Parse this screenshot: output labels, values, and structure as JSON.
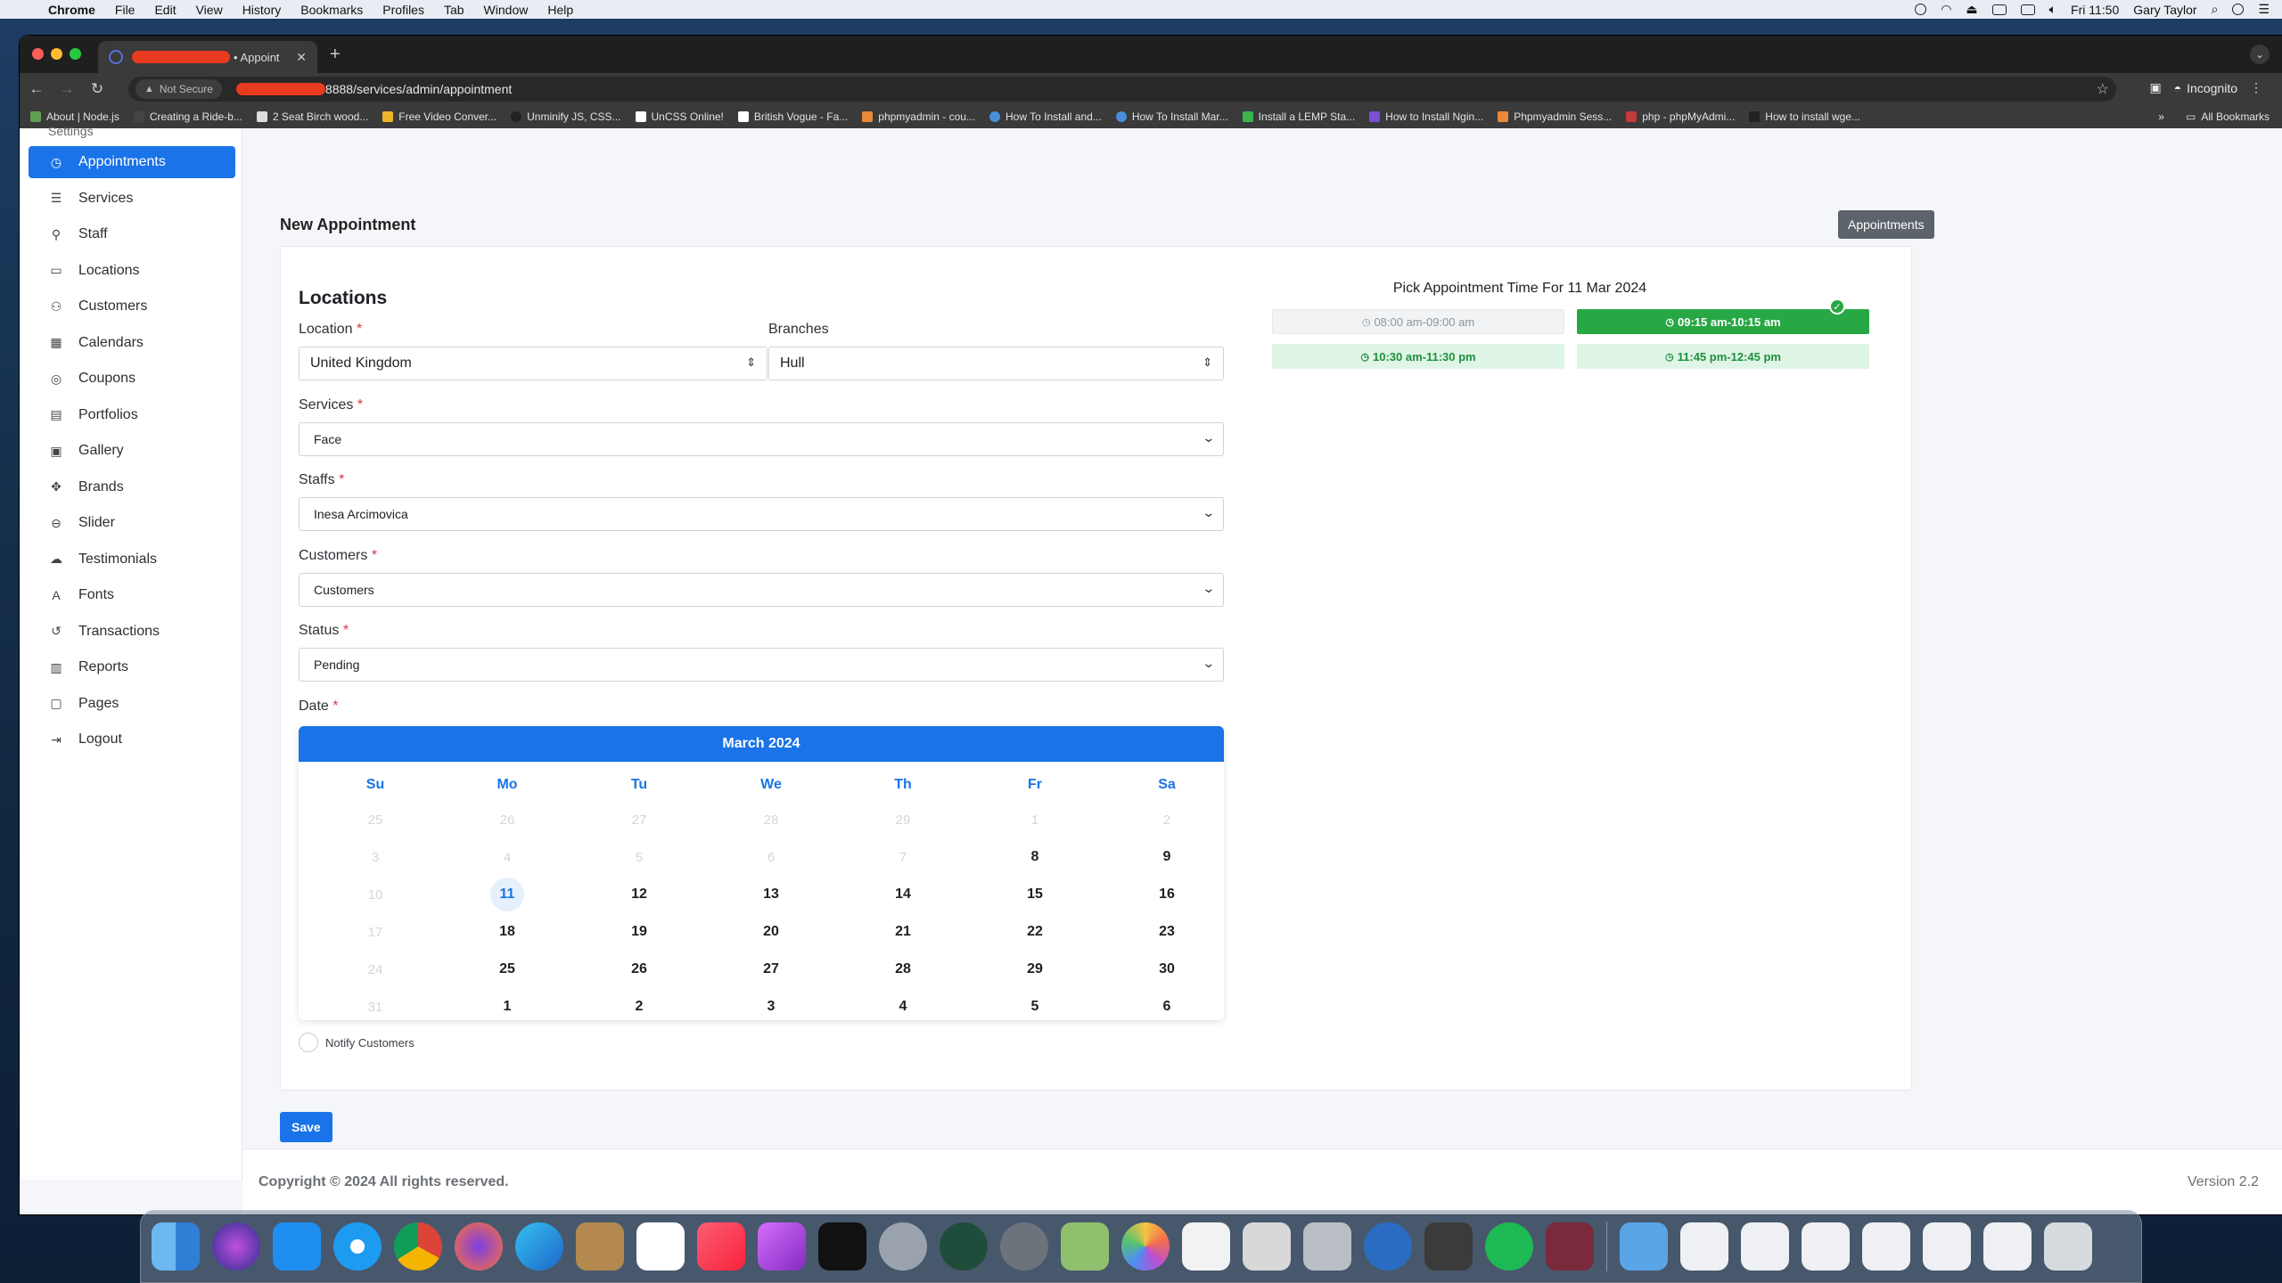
{
  "menubar": {
    "app": "Chrome",
    "items": [
      "File",
      "Edit",
      "View",
      "History",
      "Bookmarks",
      "Profiles",
      "Tab",
      "Window",
      "Help"
    ],
    "clock": "Fri 11:50",
    "user": "Gary Taylor"
  },
  "browser": {
    "tab_title": "• Appoint",
    "url": "8888/services/admin/appointment",
    "security_label": "Not Secure",
    "incognito_label": "Incognito",
    "bookmarks": [
      "About | Node.js",
      "Creating a Ride-b...",
      "2 Seat Birch wood...",
      "Free Video Conver...",
      "Unminify JS, CSS...",
      "UnCSS Online!",
      "British Vogue - Fa...",
      "phpmyadmin - cou...",
      "How To Install and...",
      "How To Install Mar...",
      "Install a LEMP Sta...",
      "How to Install Ngin...",
      "Phpmyadmin Sess...",
      "php - phpMyAdmi...",
      "How to install wge..."
    ],
    "all_bookmarks": "All Bookmarks"
  },
  "sidebar": {
    "cut_item": "Settings",
    "items": [
      {
        "label": "Appointments",
        "icon": "clock-icon",
        "glyph": "◷",
        "active": true
      },
      {
        "label": "Services",
        "icon": "layers-icon",
        "glyph": "☰"
      },
      {
        "label": "Staff",
        "icon": "staff-icon",
        "glyph": "⚲"
      },
      {
        "label": "Locations",
        "icon": "building-icon",
        "glyph": "▭"
      },
      {
        "label": "Customers",
        "icon": "users-icon",
        "glyph": "⚇"
      },
      {
        "label": "Calendars",
        "icon": "calendar-icon",
        "glyph": "▦"
      },
      {
        "label": "Coupons",
        "icon": "coupon-icon",
        "glyph": "◎"
      },
      {
        "label": "Portfolios",
        "icon": "portfolio-icon",
        "glyph": "▤"
      },
      {
        "label": "Gallery",
        "icon": "image-icon",
        "glyph": "▣"
      },
      {
        "label": "Brands",
        "icon": "brand-icon",
        "glyph": "✥"
      },
      {
        "label": "Slider",
        "icon": "slider-icon",
        "glyph": "⊖"
      },
      {
        "label": "Testimonials",
        "icon": "chat-icon",
        "glyph": "☁"
      },
      {
        "label": "Fonts",
        "icon": "font-icon",
        "glyph": "A"
      },
      {
        "label": "Transactions",
        "icon": "history-icon",
        "glyph": "↺"
      },
      {
        "label": "Reports",
        "icon": "chart-icon",
        "glyph": "▥"
      },
      {
        "label": "Pages",
        "icon": "pages-icon",
        "glyph": "▢"
      },
      {
        "label": "Logout",
        "icon": "logout-icon",
        "glyph": "⇥"
      }
    ]
  },
  "page": {
    "title": "New Appointment",
    "header_button": "Appointments",
    "section_title": "Locations",
    "location_label": "Location",
    "location_value": "United Kingdom",
    "branches_label": "Branches",
    "branches_value": "Hull",
    "services_label": "Services",
    "services_value": "Face",
    "staffs_label": "Staffs",
    "staffs_value": "Inesa Arcimovica",
    "customers_label": "Customers",
    "customers_value": "Customers",
    "status_label": "Status",
    "status_value": "Pending",
    "date_label": "Date",
    "required_mark": "*",
    "notify_label": "Notify Customers",
    "save_label": "Save"
  },
  "calendar": {
    "month": "March 2024",
    "weekdays": [
      "Su",
      "Mo",
      "Tu",
      "We",
      "Th",
      "Fr",
      "Sa"
    ],
    "weeks": [
      [
        25,
        26,
        27,
        28,
        29,
        1,
        2
      ],
      [
        3,
        4,
        5,
        6,
        7,
        8,
        9
      ],
      [
        10,
        11,
        12,
        13,
        14,
        15,
        16
      ],
      [
        17,
        18,
        19,
        20,
        21,
        22,
        23
      ],
      [
        24,
        25,
        26,
        27,
        28,
        29,
        30
      ],
      [
        31,
        1,
        2,
        3,
        4,
        5,
        6
      ]
    ],
    "disabled": [
      [
        0,
        0
      ],
      [
        0,
        1
      ],
      [
        0,
        2
      ],
      [
        0,
        3
      ],
      [
        0,
        4
      ],
      [
        0,
        5
      ],
      [
        0,
        6
      ],
      [
        1,
        0
      ],
      [
        1,
        1
      ],
      [
        1,
        2
      ],
      [
        1,
        3
      ],
      [
        1,
        4
      ],
      [
        2,
        0
      ],
      [
        3,
        0
      ],
      [
        4,
        0
      ],
      [
        5,
        0
      ]
    ],
    "today": [
      2,
      1
    ]
  },
  "time_slots": {
    "title": "Pick Appointment Time For 11 Mar 2024",
    "slots": [
      {
        "label": "08:00 am-09:00 am",
        "state": "past"
      },
      {
        "label": "09:15 am-10:15 am",
        "state": "selected"
      },
      {
        "label": "10:30 am-11:30 pm",
        "state": "available"
      },
      {
        "label": "11:45 pm-12:45 pm",
        "state": "available"
      }
    ]
  },
  "footer": {
    "copyright": "Copyright © 2024 All rights reserved.",
    "version": "Version 2.2"
  },
  "colors": {
    "primary": "#1a73e8",
    "success": "#28a745",
    "required": "#dc3545"
  }
}
